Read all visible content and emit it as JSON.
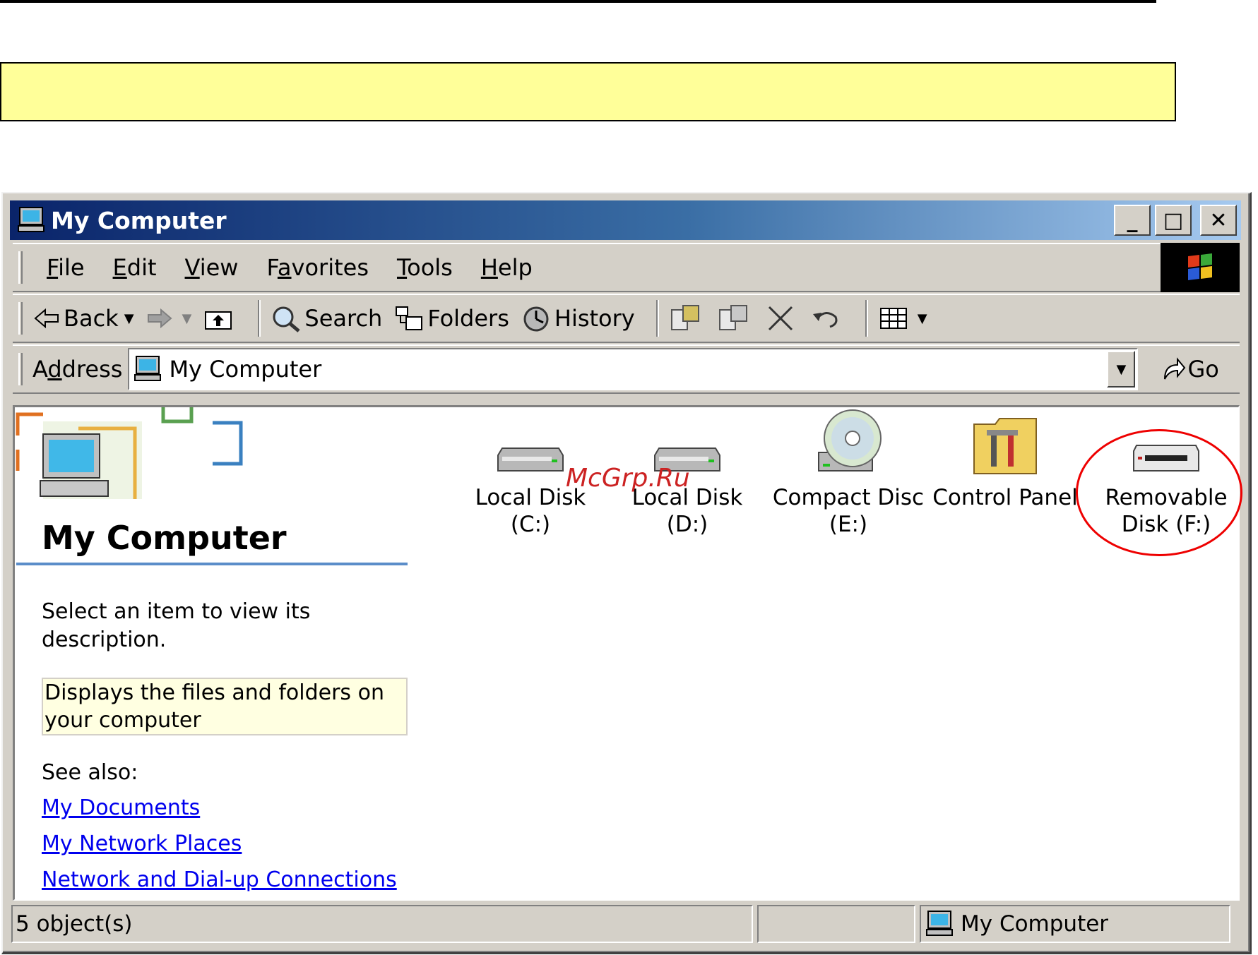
{
  "window": {
    "title": "My Computer",
    "controls": {
      "minimize": "_",
      "maximize": "□",
      "close": "✕"
    }
  },
  "menubar": {
    "items": [
      {
        "pre": "",
        "u": "F",
        "post": "ile"
      },
      {
        "pre": "",
        "u": "E",
        "post": "dit"
      },
      {
        "pre": "",
        "u": "V",
        "post": "iew"
      },
      {
        "pre": "F",
        "u": "a",
        "post": "vorites"
      },
      {
        "pre": "",
        "u": "T",
        "post": "ools"
      },
      {
        "pre": "",
        "u": "H",
        "post": "elp"
      }
    ]
  },
  "toolbar": {
    "back_label": "Back",
    "search_label": "Search",
    "folders_label": "Folders",
    "history_label": "History"
  },
  "address": {
    "label_pre": "A",
    "label_u": "d",
    "label_post": "dress",
    "value": "My Computer",
    "go_label": "Go"
  },
  "sidebar": {
    "title": "My Computer",
    "description": "Select an item to view its description.",
    "infotip": "Displays the files and folders on your computer",
    "see_also_label": "See also:",
    "links": [
      "My Documents",
      "My Network Places",
      "Network and Dial-up Connections"
    ]
  },
  "items": [
    {
      "label": "Local Disk (C:)",
      "icon": "hard-disk-icon"
    },
    {
      "label": "Local Disk (D:)",
      "icon": "hard-disk-icon"
    },
    {
      "label": "Compact Disc (E:)",
      "icon": "cd-drive-icon"
    },
    {
      "label": "Control Panel",
      "icon": "control-panel-icon"
    },
    {
      "label": "Removable Disk (F:)",
      "icon": "removable-disk-icon"
    }
  ],
  "watermark": "McGrp.Ru",
  "statusbar": {
    "objects": "5 object(s)",
    "location": "My Computer"
  },
  "colors": {
    "title_gradient_start": "#0a246a",
    "title_gradient_end": "#a6caf0",
    "face": "#d4d0c8",
    "banner_yellow": "#ffff99",
    "highlight_circle": "#e00000",
    "link": "#0000ee"
  }
}
